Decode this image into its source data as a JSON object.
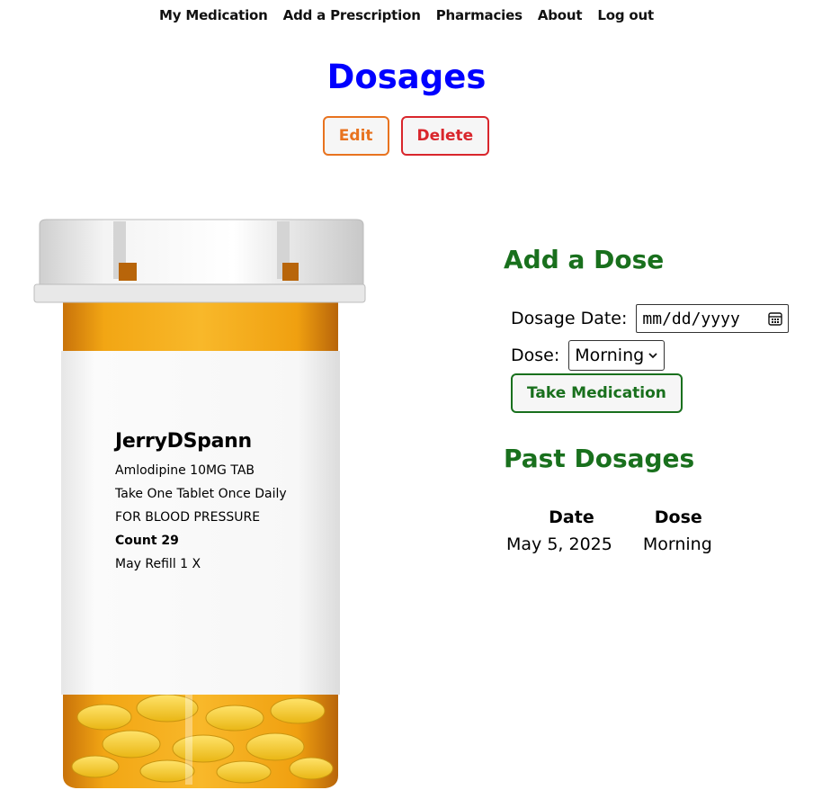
{
  "nav": {
    "items": [
      "My Medication",
      "Add a Prescription",
      "Pharmacies",
      "About",
      "Log out"
    ]
  },
  "page": {
    "title": "Dosages",
    "edit_label": "Edit",
    "delete_label": "Delete"
  },
  "prescription": {
    "patient": "JerryDSpann",
    "drug": "Amlodipine 10MG TAB",
    "instructions": "Take One Tablet Once Daily",
    "purpose": "FOR BLOOD PRESSURE",
    "count": "Count 29",
    "refill": "May Refill 1 X"
  },
  "add_dose": {
    "heading": "Add a Dose",
    "date_label": "Dosage Date:",
    "date_placeholder": "mm/dd/yyyy",
    "dose_label": "Dose:",
    "dose_selected": "Morning",
    "submit_label": "Take Medication"
  },
  "past": {
    "heading": "Past Dosages",
    "columns": [
      "Date",
      "Dose"
    ],
    "rows": [
      [
        "May 5, 2025",
        "Morning"
      ]
    ]
  },
  "colors": {
    "title": "#0000ff",
    "heading": "#19701d",
    "edit": "#e8731f",
    "delete": "#d9262c"
  }
}
